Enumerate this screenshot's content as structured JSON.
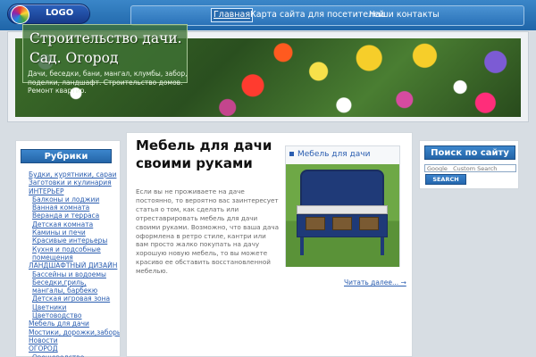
{
  "header": {
    "logo_text": "LOGO",
    "nav": [
      {
        "label": "Главная",
        "active": true
      },
      {
        "label": "Карта сайта для посетителей",
        "active": false
      },
      {
        "label": "Наши контакты",
        "active": false
      }
    ]
  },
  "banner": {
    "title": "Строительство дачи. Сад. Огород",
    "subtitle": "Дачи, беседки, бани, мангал, клумбы, забор, поделки, ландшафт. Строительство домов. Ремонт квартир."
  },
  "sidebar": {
    "heading": "Рубрики",
    "categories": [
      {
        "label": "Будки, курятники, сараи",
        "sub": false
      },
      {
        "label": "Заготовки и кулинария",
        "sub": false
      },
      {
        "label": "ИНТЕРЬЕР",
        "sub": false
      },
      {
        "label": "Балконы и лоджии",
        "sub": true
      },
      {
        "label": "Ванная комната",
        "sub": true
      },
      {
        "label": "Веранда и терраса",
        "sub": true
      },
      {
        "label": "Детская комната",
        "sub": true
      },
      {
        "label": "Камины и печи",
        "sub": true
      },
      {
        "label": "Красивые интерьеры",
        "sub": true
      },
      {
        "label": "Кухня и подсобные помещения",
        "sub": true,
        "multi": true
      },
      {
        "label": "ЛАНДШАФТНЫЙ ДИЗАЙН",
        "sub": false
      },
      {
        "label": "Бассейны и водоемы",
        "sub": true
      },
      {
        "label": "Беседки,гриль, мангалы, барбекю",
        "sub": true,
        "multi": true
      },
      {
        "label": "Детская игровая зона",
        "sub": true
      },
      {
        "label": "Цветники",
        "sub": true
      },
      {
        "label": "Цветоводство",
        "sub": true
      },
      {
        "label": "Мебель для дачи",
        "sub": false
      },
      {
        "label": "Мостики, дорожки,заборы",
        "sub": false
      },
      {
        "label": "Новости",
        "sub": false
      },
      {
        "label": "ОГОРОД",
        "sub": false
      },
      {
        "label": "Овощеводство",
        "sub": true
      }
    ]
  },
  "main": {
    "post_title": "Мебель для дачи своими руками",
    "post_text": "Если вы не проживаете на даче постоянно, то вероятно вас заинтересует статья о том, как сделать или отреставрировать мебель для дачи своими руками. Возможно, что ваша дача оформлена в ретро стиле, кантри или вам просто жалко покупать на дачу хорошую новую мебель, то вы можете красиво ее обставить восстановленной мебелью.",
    "read_more": "Читать далее... →",
    "image_caption": "Мебель для дачи"
  },
  "search": {
    "heading": "Поиск по сайту",
    "placeholder": "Google   Custom Search",
    "button": "SEARCH"
  }
}
